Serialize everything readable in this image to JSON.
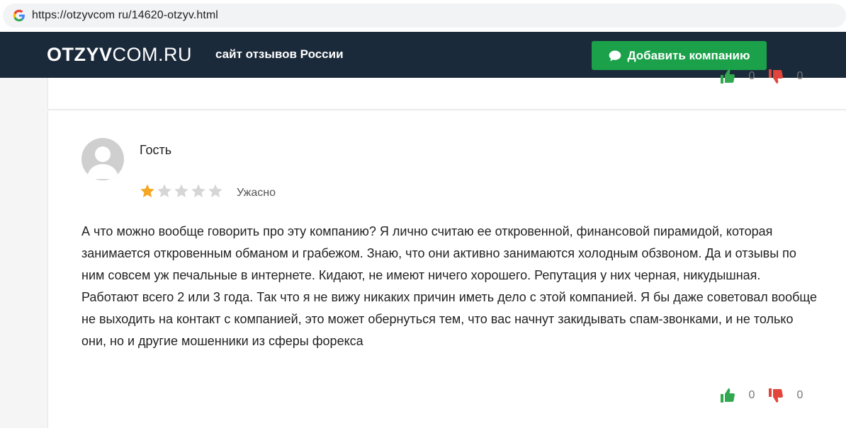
{
  "browser": {
    "url": "https://otzyvcom ru/14620-otzyv.html",
    "favicon": "google-g-icon"
  },
  "header": {
    "logo_bold": "OTZYV",
    "logo_light": "COM.RU",
    "tagline": "сайт отзывов России",
    "add_button_label": "Добавить компанию",
    "add_button_icon": "chat-bubble-icon",
    "colors": {
      "header_bg": "#1b2a3a",
      "button_bg": "#1aa14a"
    }
  },
  "previous_review": {
    "likes": "0",
    "dislikes": "0"
  },
  "review": {
    "author": "Гость",
    "avatar": "user-avatar-icon",
    "rating": 1,
    "rating_max": 5,
    "rating_label": "Ужасно",
    "text": "А что можно вообще говорить про эту компанию? Я лично считаю ее откровенной, финансовой пирамидой, которая занимается откровенным обманом и грабежом. Знаю, что они активно занимаются холодным обзвоном. Да и отзывы по ним совсем уж печальные в интернете. Кидают, не имеют ничего хорошего. Репутация у них черная, никудышная. Работают всего 2 или 3 года. Так что я не вижу никаких причин иметь дело с этой компанией. Я бы даже советовал вообще не выходить на контакт с компанией, это может обернуться тем, что вас начнут закидывать спам-звонками, и не только они, но и другие мошенники из сферы форекса",
    "likes": "0",
    "dislikes": "0",
    "colors": {
      "star_filled": "#f5a623",
      "star_empty": "#d6d6d6",
      "like": "#2fa84f",
      "dislike": "#e2453c"
    }
  }
}
